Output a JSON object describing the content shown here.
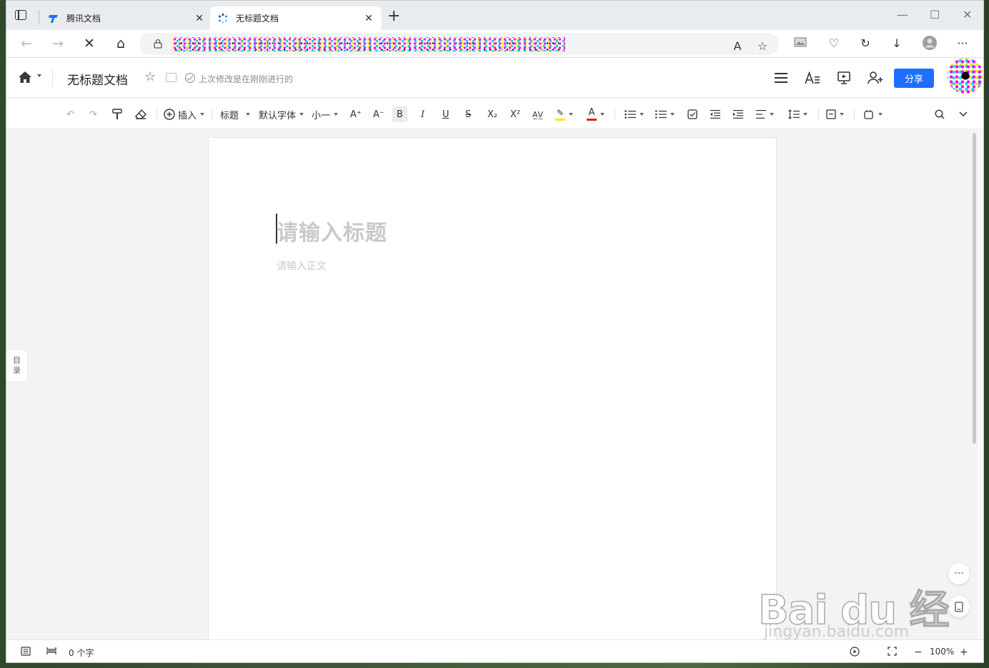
{
  "tabs": [
    {
      "title": "腾讯文档",
      "close": "✕"
    },
    {
      "title": "无标题文档",
      "close": "✕"
    }
  ],
  "new_tab": "+",
  "window_controls": {
    "minimize": "—",
    "maximize": "☐",
    "close": "✕"
  },
  "nav": {
    "back": "←",
    "forward": "→",
    "stop": "✕",
    "home": "⌂"
  },
  "addr_icons": {
    "read_aloud": "A",
    "favorite_add": "☆",
    "collections": "♡",
    "history": "↻",
    "downloads": "↓",
    "profile": "●",
    "more": "···"
  },
  "doc": {
    "title": "无标题文档",
    "save_status": "上次修改是在刚刚进行的",
    "share_label": "分享"
  },
  "toolbar": {
    "undo": "↶",
    "redo": "↷",
    "format_painter": "🖌",
    "clear_format": "⌫",
    "insert": "插入",
    "heading": "标题",
    "font": "默认字体",
    "size": "小一",
    "font_grow": "A⁺",
    "font_shrink": "A⁻",
    "bold": "B",
    "italic": "I",
    "underline": "U",
    "strike": "S",
    "subscript": "X₂",
    "superscript": "X²",
    "spell": "A̲V̲",
    "highlight": "✎",
    "font_color": "A",
    "highlight_color": "#ffe600",
    "font_color_bar": "#e02020"
  },
  "editor": {
    "title_placeholder": "请输入标题",
    "body_placeholder": "请输入正文"
  },
  "toc": {
    "line1": "目",
    "line2": "录"
  },
  "float": {
    "more": "···",
    "mobile": "▯"
  },
  "watermark": {
    "brand": "Bai du 经验",
    "url": "jingyan.baidu.com"
  },
  "status": {
    "word_count": "0 个字",
    "zoom": "100%",
    "zoom_out": "−",
    "zoom_in": "+"
  },
  "colors": {
    "accent": "#1e6fff"
  }
}
